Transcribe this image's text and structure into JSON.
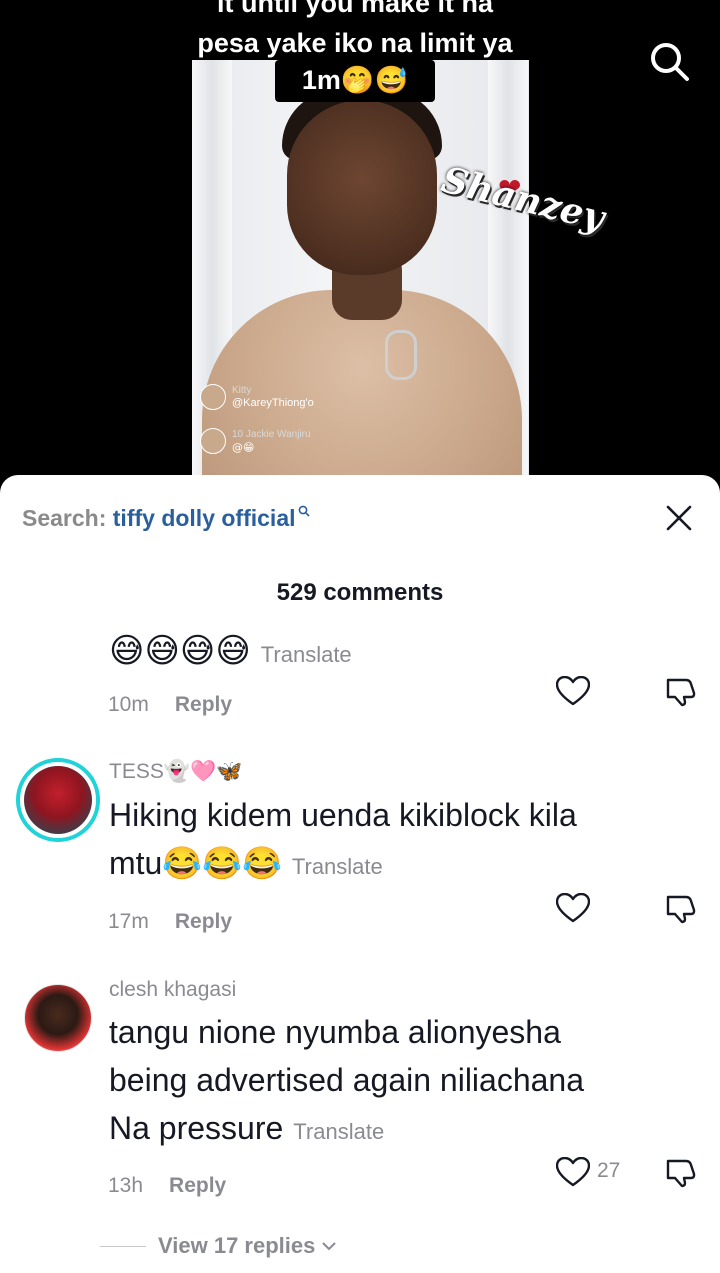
{
  "video": {
    "caption_line1": "it until you make it na",
    "caption_line2": "pesa yake iko na limit ya",
    "caption_line3": "1m🤭😅",
    "watermark": "Shanzey",
    "live_comments": [
      {
        "name": "Kitty",
        "text": "@KareyThiong'o"
      },
      {
        "name": "Jackie Wanjiru",
        "badge": "10",
        "text": "@😁"
      }
    ]
  },
  "sheet": {
    "search_label": "Search:",
    "search_query": "tiffy dolly official",
    "comment_count": "529 comments",
    "translate_label": "Translate",
    "reply_label": "Reply",
    "view_replies": "View 17 replies"
  },
  "comments": [
    {
      "text": "😅😅😅😅",
      "time": "10m"
    },
    {
      "username": "TESS👻🩷🦋",
      "text_line1": "Hiking kidem uenda kikiblock kila",
      "text_line2": "mtu😂😂😂",
      "time": "17m"
    },
    {
      "username": "clesh khagasi",
      "text_line1": "tangu nione nyumba alionyesha",
      "text_line2": "being advertised again niliachana",
      "text_line3": "Na pressure",
      "time": "13h",
      "likes": "27"
    }
  ],
  "colors": {
    "accent_ring": "#1fd3d8",
    "link": "#2a5f9e",
    "muted": "#8a8b91"
  }
}
